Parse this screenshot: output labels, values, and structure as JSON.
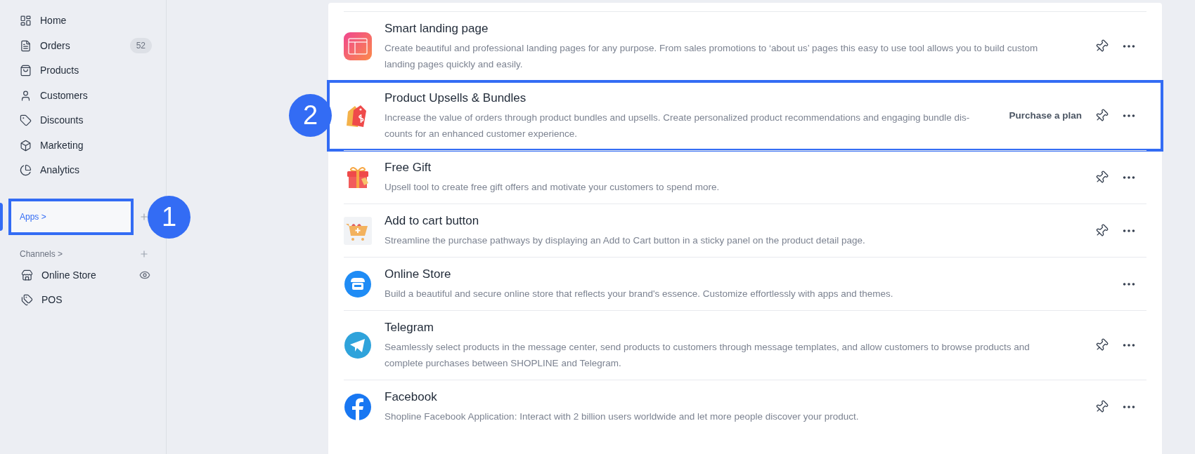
{
  "sidebar": {
    "items": [
      {
        "label": "Home",
        "selected": false
      },
      {
        "label": "Orders",
        "selected": false,
        "count": "52"
      },
      {
        "label": "Products",
        "selected": false
      },
      {
        "label": "Customers",
        "selected": false
      },
      {
        "label": "Discounts",
        "selected": false
      },
      {
        "label": "Marketing",
        "selected": false
      },
      {
        "label": "Analytics",
        "selected": false
      }
    ],
    "apps": {
      "label": "Apps >",
      "selected": true,
      "callout": "1"
    },
    "channels": {
      "label": "Channels >",
      "items": [
        {
          "label": "Online Store",
          "visible_toggle": true
        },
        {
          "label": "POS",
          "visible_toggle": false
        }
      ]
    }
  },
  "apps": [
    {
      "name": "Smart landing page",
      "description": "Create beautiful and professional landing pages for any purpose. From sales promotions to ‘about us’ pages this easy to use tool allows you to build custom landing pages quickly and easily.",
      "pinnable": true
    },
    {
      "name": "Product Upsells & Bundles",
      "description": "Increase the value of orders through product bundles and upsells. Create personalized product recommendations and engaging bundle dis-counts for an enhanced customer experience.",
      "pinnable": true,
      "action": "Purchase a plan",
      "callout": "2"
    },
    {
      "name": "Free Gift",
      "description": "Upsell tool to create free gift offers and motivate your customers to spend more.",
      "pinnable": true
    },
    {
      "name": "Add to cart button",
      "description": "Streamline the purchase pathways by displaying an Add to Cart button in a sticky panel on the product detail page.",
      "pinnable": true
    },
    {
      "name": "Online Store",
      "description": "Build a beautiful and secure online store that reflects your brand's essence. Customize effortlessly with apps and themes.",
      "pinnable": false
    },
    {
      "name": "Telegram",
      "description": "Seamlessly select products in the message center, send products to customers through message templates, and allow customers to browse products and complete purchases between SHOPLINE and Telegram.",
      "pinnable": true
    },
    {
      "name": "Facebook",
      "description": "Shopline Facebook Application: Interact with 2 billion users worldwide and let more people discover your product.",
      "pinnable": true
    }
  ]
}
